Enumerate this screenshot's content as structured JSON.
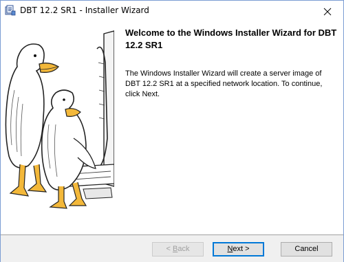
{
  "window": {
    "title": "DBT 12.2 SR1 - Installer Wizard"
  },
  "content": {
    "heading": "Welcome to the Windows Installer Wizard for DBT 12.2 SR1",
    "body": "The Windows Installer Wizard will create a server image of DBT 12.2 SR1 at a specified network location. To continue, click Next."
  },
  "buttons": {
    "back": {
      "label_prefix": "< ",
      "label_mnemonic": "B",
      "label_rest": "ack",
      "enabled": false
    },
    "next": {
      "label_prefix": "",
      "label_mnemonic": "N",
      "label_rest": "ext >",
      "enabled": true
    },
    "cancel": {
      "label": "Cancel",
      "enabled": true
    }
  },
  "icons": {
    "app": "installer-app-icon",
    "close": "close-icon",
    "illustration": "ducks-at-computer-illustration"
  },
  "colors": {
    "accent": "#0078d7",
    "bottom_bar": "#f0f0f0"
  }
}
